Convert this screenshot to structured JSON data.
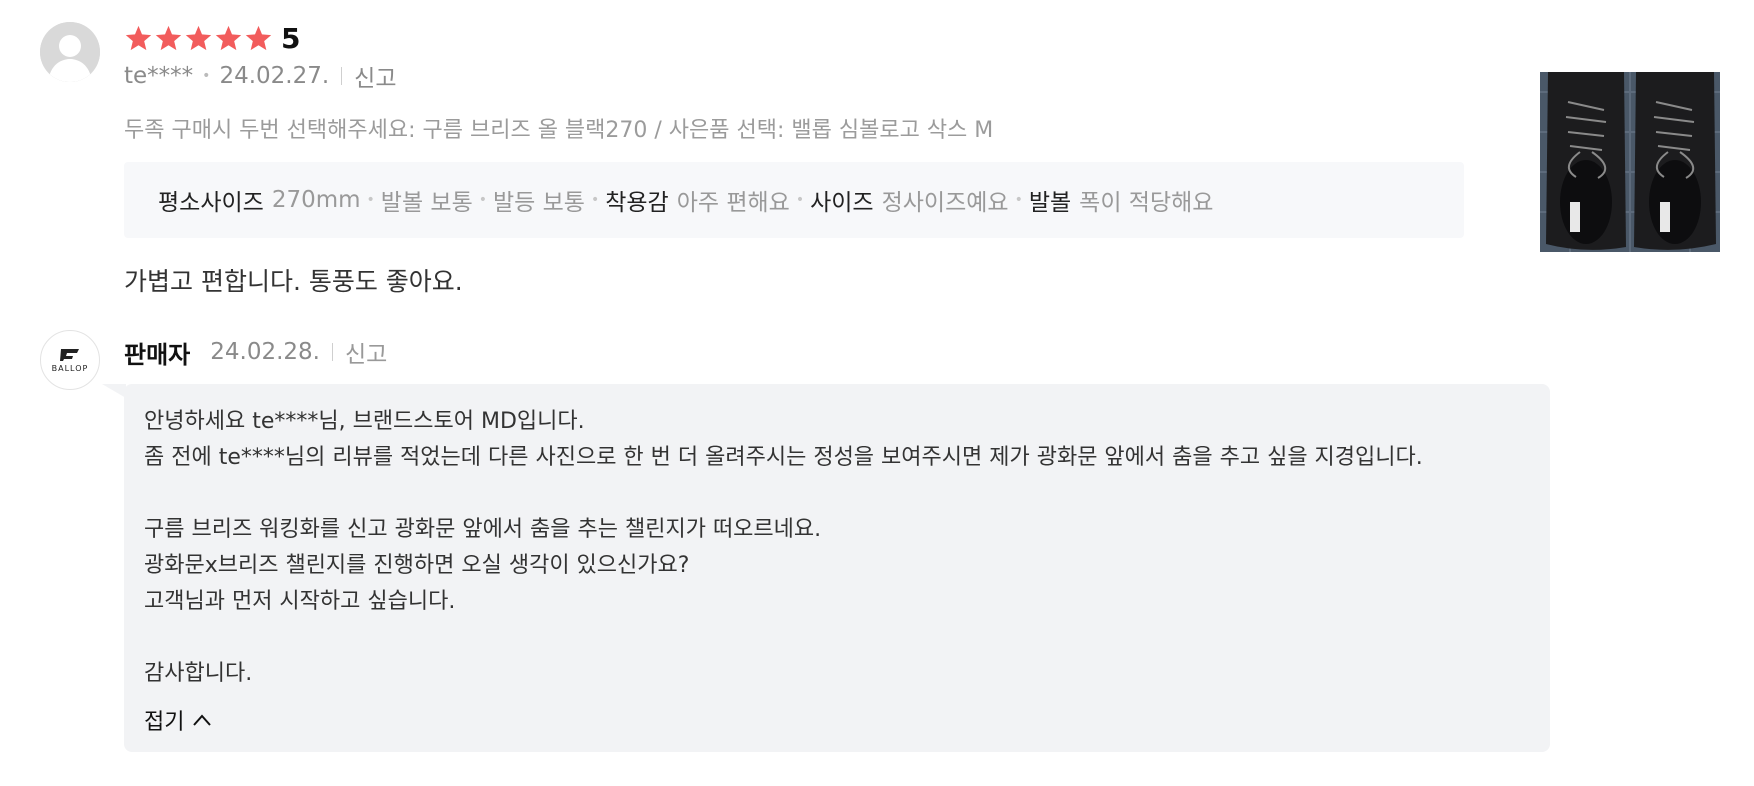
{
  "review": {
    "rating_value": "5",
    "stars_filled": 5,
    "star_color": "#f25c5c",
    "author": "te****",
    "date": "24.02.27.",
    "report_label": "신고",
    "option_text": "두족 구매시 두번 선택해주세요: 구름 브리즈 올 블랙270 / 사은품 선택: 밸롭 심볼로고 삭스 M",
    "attributes": [
      {
        "key": "평소사이즈",
        "value": "270mm"
      },
      {
        "key": "",
        "value": "발볼 보통"
      },
      {
        "key": "",
        "value": "발등 보통"
      },
      {
        "key": "착용감",
        "value": "아주 편해요"
      },
      {
        "key": "사이즈",
        "value": "정사이즈예요"
      },
      {
        "key": "발볼",
        "value": "폭이 적당해요"
      }
    ],
    "body": "가볍고 편합니다. 통풍도 좋아요.",
    "photo_icon": "black-sneakers-photo"
  },
  "seller_reply": {
    "name": "판매자",
    "logo_text": "BALLOP",
    "date": "24.02.28.",
    "report_label": "신고",
    "lines": [
      "안녕하세요 te****님, 브랜드스토어 MD입니다.",
      "좀 전에 te****님의 리뷰를 적었는데 다른 사진으로 한 번 더 올려주시는 정성을 보여주시면 제가 광화문 앞에서 춤을 추고 싶을 지경입니다.",
      "",
      "구름 브리즈 워킹화를 신고 광화문 앞에서 춤을 추는 챌린지가 떠오르네요.",
      "광화문x브리즈 챌린지를 진행하면 오실 생각이 있으신가요?",
      "고객님과 먼저 시작하고 싶습니다.",
      "",
      "감사합니다."
    ],
    "fold_label": "접기"
  }
}
